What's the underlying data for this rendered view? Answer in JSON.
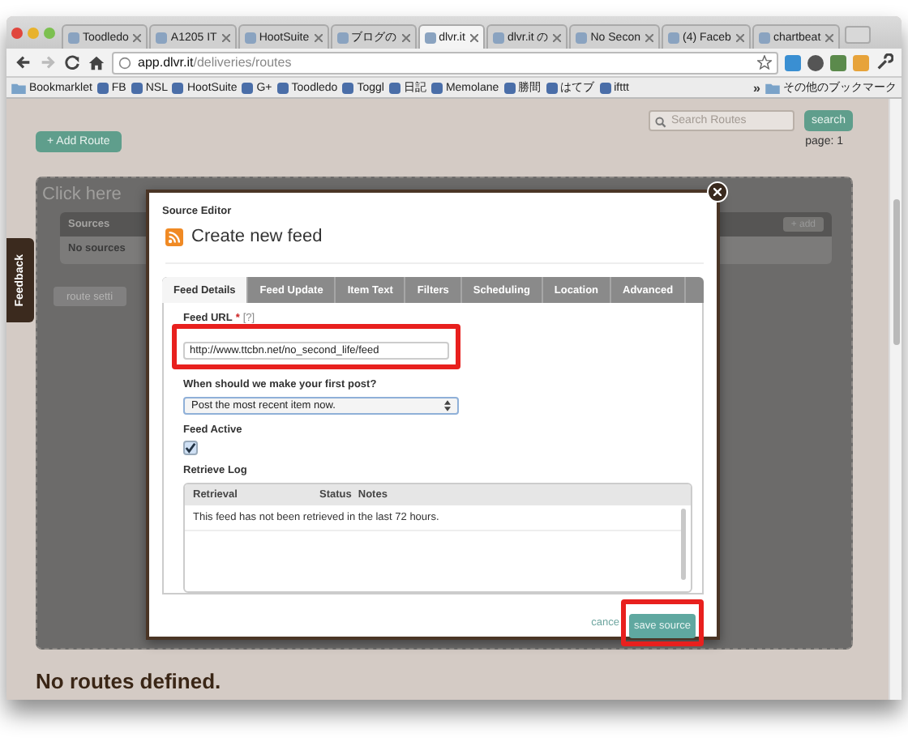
{
  "browser": {
    "tabs": [
      {
        "label": "Toodledo",
        "selected": false
      },
      {
        "label": "A1205 IT",
        "selected": false
      },
      {
        "label": "HootSuite",
        "selected": false
      },
      {
        "label": "ブログの",
        "selected": false
      },
      {
        "label": "dlvr.it",
        "selected": true
      },
      {
        "label": "dlvr.it の",
        "selected": false
      },
      {
        "label": "No Secon",
        "selected": false
      },
      {
        "label": "(4) Faceb",
        "selected": false
      },
      {
        "label": "chartbeat",
        "selected": false
      }
    ],
    "url": {
      "host": "app.dlvr.it",
      "path": "/deliveries/routes"
    },
    "bookmarks": [
      {
        "label": "Bookmarklet",
        "kind": "folder"
      },
      {
        "label": "FB",
        "kind": "site"
      },
      {
        "label": "NSL",
        "kind": "site"
      },
      {
        "label": "HootSuite",
        "kind": "site"
      },
      {
        "label": "G+",
        "kind": "site"
      },
      {
        "label": "Toodledo",
        "kind": "site"
      },
      {
        "label": "Toggl",
        "kind": "site"
      },
      {
        "label": "日記",
        "kind": "site"
      },
      {
        "label": "Memolane",
        "kind": "site"
      },
      {
        "label": "勝間",
        "kind": "site"
      },
      {
        "label": "はてブ",
        "kind": "site"
      },
      {
        "label": "ifttt",
        "kind": "site"
      }
    ],
    "overflow": "»",
    "other_bookmarks": "その他のブックマーク"
  },
  "page": {
    "search": {
      "placeholder": "Search Routes",
      "button": "search"
    },
    "add_route": "+ Add Route",
    "pagination": "page: 1",
    "feedback": "Feedback",
    "background": {
      "title": "Click here",
      "sources_header": "Sources",
      "add_source": "+ add",
      "no_sources": "No sources",
      "route_settings": "route setti"
    },
    "empty": "No routes defined."
  },
  "modal": {
    "caption": "Source Editor",
    "title": "Create new feed",
    "tabs": [
      {
        "label": "Feed Details",
        "selected": true
      },
      {
        "label": "Feed Update",
        "selected": false
      },
      {
        "label": "Item Text",
        "selected": false
      },
      {
        "label": "Filters",
        "selected": false
      },
      {
        "label": "Scheduling",
        "selected": false
      },
      {
        "label": "Location",
        "selected": false
      },
      {
        "label": "Advanced",
        "selected": false
      }
    ],
    "feed_url": {
      "label": "Feed URL",
      "required": "*",
      "help": "[?]",
      "value": "http://www.ttcbn.net/no_second_life/feed",
      "highlighted": true
    },
    "first_post": {
      "label": "When should we make your first post?",
      "value": "Post the most recent item now."
    },
    "feed_active": {
      "label": "Feed Active",
      "checked": true
    },
    "log": {
      "title": "Retrieve Log",
      "columns": [
        "Retrieval",
        "Status",
        "Notes"
      ],
      "rows": [
        "This feed has not been retrieved in the last 72 hours."
      ]
    },
    "cancel": "cance",
    "save": {
      "label": "save source",
      "highlighted": true
    }
  }
}
